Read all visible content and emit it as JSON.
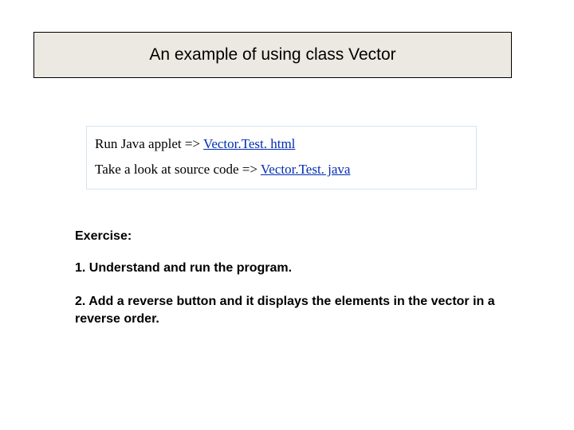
{
  "title": "An example of using class Vector",
  "links": {
    "line1_prefix": "Run Java applet => ",
    "line1_link": "Vector.Test. html",
    "line2_prefix": "Take a look at source code => ",
    "line2_link": "Vector.Test. java"
  },
  "exercise": {
    "label": "Exercise:",
    "item1": "1. Understand and run the program.",
    "item2": "2.  Add a reverse button and it displays the elements   in the vector in a reverse order."
  }
}
